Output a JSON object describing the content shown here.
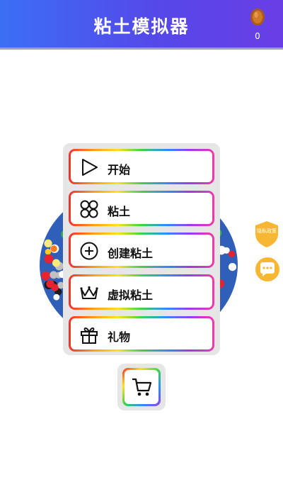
{
  "header": {
    "title": "粘土模拟器",
    "coin_count": "0",
    "coin_icon": "coin-icon",
    "gradient_colors": [
      "#3b6ff5",
      "#6a3ee6"
    ]
  },
  "menu": {
    "items": [
      {
        "label": "开始",
        "icon": "play-icon"
      },
      {
        "label": "粘土",
        "icon": "clay-circles-icon"
      },
      {
        "label": "创建粘土",
        "icon": "plus-circle-icon"
      },
      {
        "label": "虚拟粘土",
        "icon": "crown-icon"
      },
      {
        "label": "礼物",
        "icon": "gift-icon"
      }
    ]
  },
  "cart": {
    "icon": "cart-icon"
  },
  "side": {
    "privacy_label": "隐私政策",
    "privacy_icon": "shield-icon",
    "chat_icon": "chat-icon",
    "accent_color": "#f7b733"
  }
}
